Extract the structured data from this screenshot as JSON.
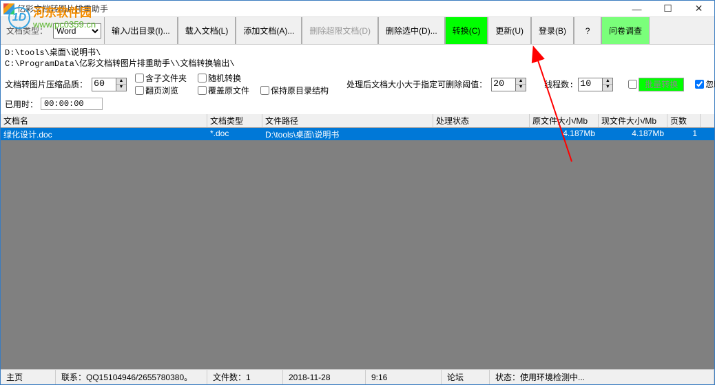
{
  "window": {
    "title": "亿彩文档转图片排重助手"
  },
  "watermark": {
    "brand": "河东软件园",
    "url": "www.pc0359.cn",
    "logo_letter": "1D"
  },
  "toolbar": {
    "doc_type_label": "文档类型：",
    "doc_type_value": "Word",
    "io_dir": "输入/出目录(I)...",
    "load_doc": "载入文档(L)",
    "add_doc": "添加文档(A)...",
    "del_over": "删除超限文档(D)",
    "del_selected": "删除选中(D)...",
    "convert": "转换(C)",
    "update": "更新(U)",
    "login": "登录(B)",
    "question": "?",
    "survey": "问卷调查"
  },
  "paths": {
    "input": "D:\\tools\\桌面\\说明书\\",
    "output": "C:\\ProgramData\\亿彩文档转图片排重助手\\\\文档转换输出\\"
  },
  "options": {
    "quality_label": "文档转图片压缩品质：",
    "quality_value": "60",
    "include_subfolders": "含子文件夹",
    "flip_preview": "翻页浏览",
    "random_convert": "随机转换",
    "overwrite": "覆盖原文件",
    "keep_structure": "保持原目录结构",
    "threshold_label": "处理后文档大小大于指定可删除阈值：",
    "threshold_value": "20",
    "threads_label": "线程数:",
    "threads_value": "10",
    "batch_convert": "批量转换",
    "ignore_pagecode": "忽略页码",
    "elapsed_label": "已用时：",
    "elapsed_value": "00:00:00"
  },
  "table": {
    "headers": {
      "name": "文档名",
      "type": "文档类型",
      "path": "文件路径",
      "status": "处理状态",
      "origsize": "原文件大小/Mb",
      "newsize": "现文件大小/Mb",
      "pages": "页数"
    },
    "rows": [
      {
        "name": "绿化设计.doc",
        "type": "*.doc",
        "path": "D:\\tools\\桌面\\说明书",
        "status": "",
        "origsize": "4.187Mb",
        "newsize": "4.187Mb",
        "pages": "1"
      }
    ]
  },
  "statusbar": {
    "home": "主页",
    "contact": "联系：QQ15104946/2655780380。",
    "filecount": "文件数：1",
    "date": "2018-11-28",
    "time": "9:16",
    "forum": "论坛",
    "status": "状态：使用环境检测中..."
  }
}
